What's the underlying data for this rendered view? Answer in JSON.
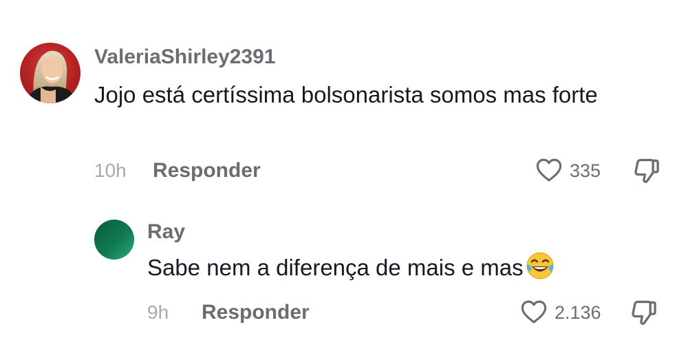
{
  "comments": [
    {
      "username": "ValeriaShirley2391",
      "text": "Jojo está certíssima bolsonarista somos mas forte",
      "time": "10h",
      "reply_label": "Responder",
      "likes": "335",
      "avatar_icon": "user-photo-avatar",
      "like_icon": "heart-outline-icon",
      "dislike_icon": "thumbs-down-outline-icon"
    },
    {
      "username": "Ray",
      "text": "Sabe nem a diferença de mais e mas",
      "emoji": "face-with-tears-of-joy",
      "time": "9h",
      "reply_label": "Responder",
      "likes": "2.136",
      "avatar_icon": "green-gradient-avatar",
      "like_icon": "heart-outline-icon",
      "dislike_icon": "thumbs-down-outline-icon"
    }
  ],
  "colors": {
    "username": "#6b6d73",
    "text": "#161823",
    "timestamp": "#a8a9ad",
    "icon": "#6b6d73",
    "avatar_green": "#0f7a52"
  }
}
